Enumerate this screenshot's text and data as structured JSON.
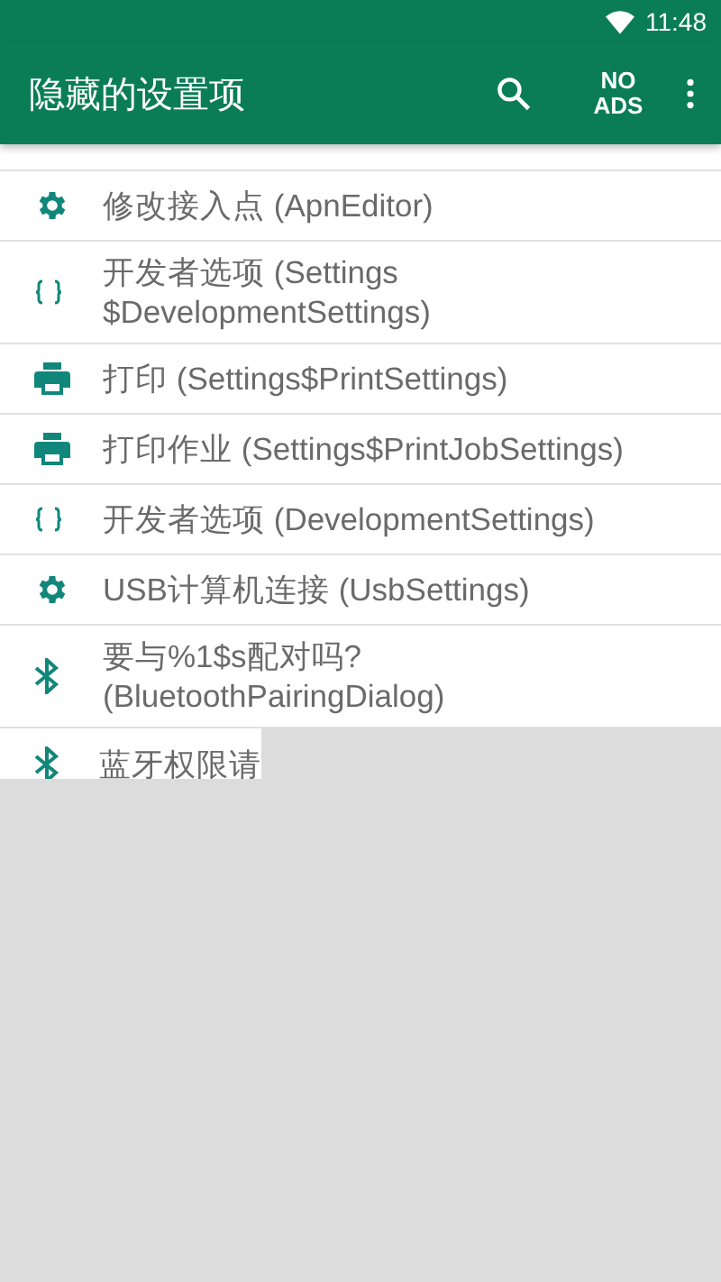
{
  "status_bar": {
    "time": "11:48"
  },
  "app_bar": {
    "title": "隐藏的设置项",
    "no_ads": "NO ADS"
  },
  "items": [
    {
      "kind": "gear",
      "label": "修改接入点 (ApnEditor)"
    },
    {
      "kind": "braces",
      "label": "开发者选项 (Settings $DevelopmentSettings)"
    },
    {
      "kind": "printer",
      "label": "打印 (Settings$PrintSettings)"
    },
    {
      "kind": "printer",
      "label": "打印作业 (Settings$PrintJobSettings)"
    },
    {
      "kind": "braces",
      "label": "开发者选项 (DevelopmentSettings)"
    },
    {
      "kind": "gear",
      "label": "USB计算机连接 (UsbSettings)"
    },
    {
      "kind": "bluetooth",
      "label": "要与%1$s配对吗? (BluetoothPairingDialog)"
    },
    {
      "kind": "bluetooth",
      "label": "蓝牙权限请"
    }
  ]
}
